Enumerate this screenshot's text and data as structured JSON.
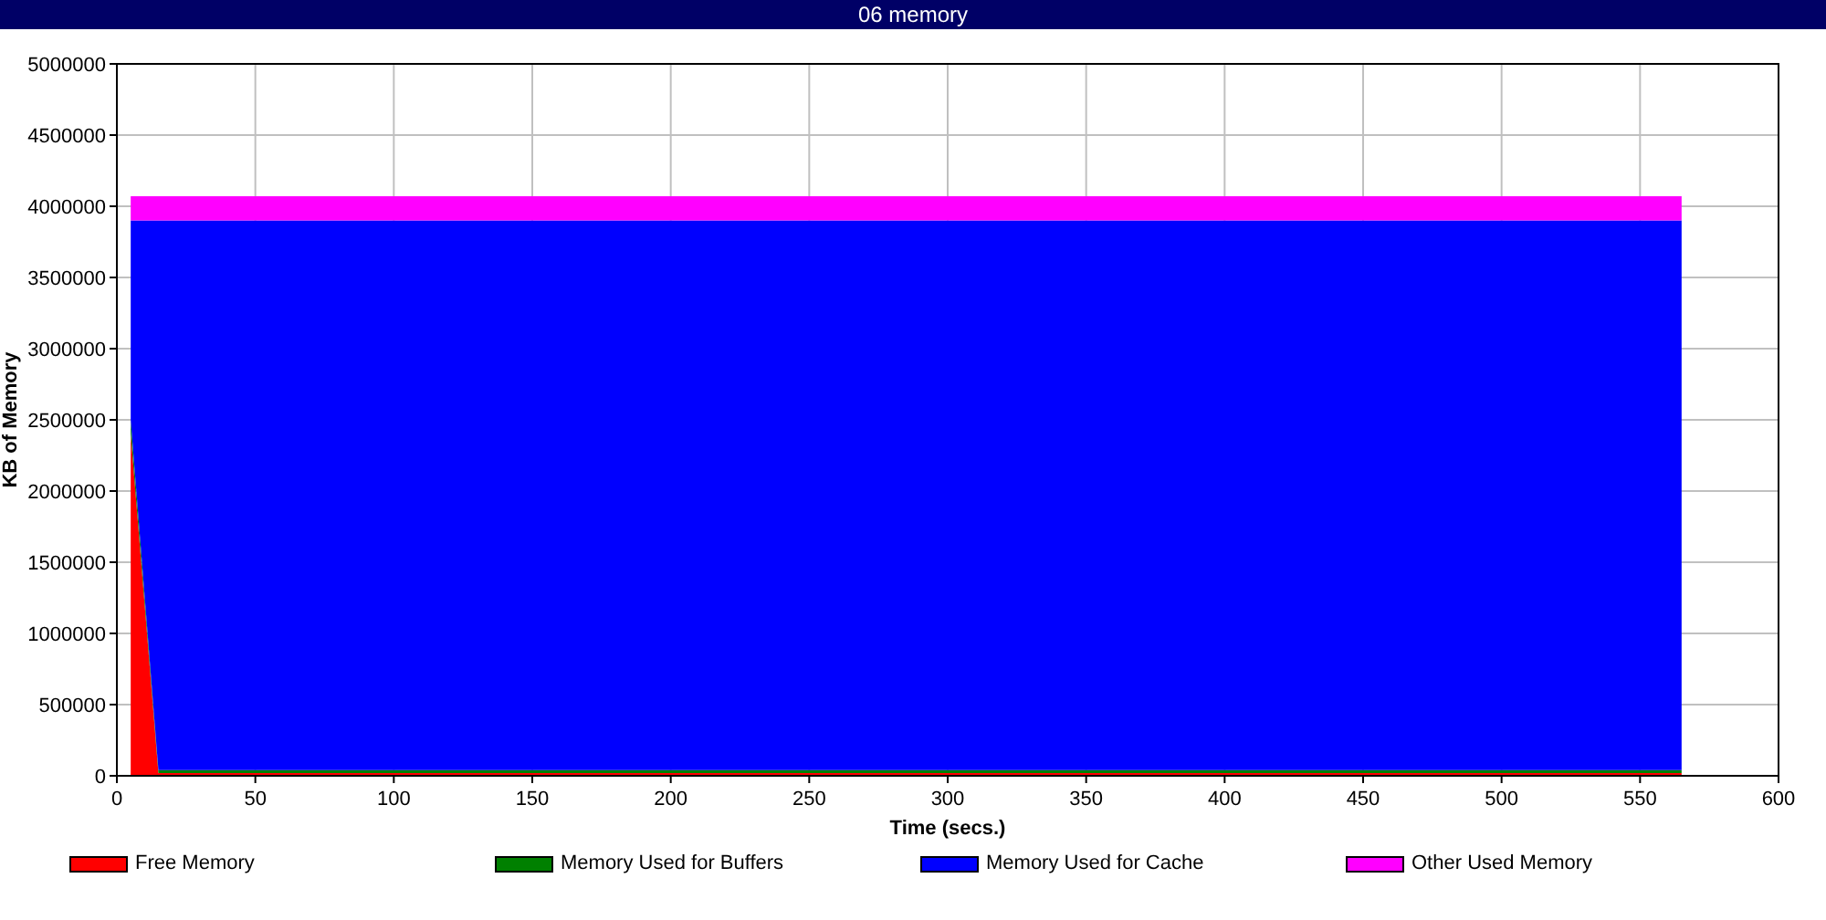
{
  "window": {
    "title": "06 memory"
  },
  "chart": {
    "chart_data": {
      "type": "area",
      "stacked": true,
      "grid": true,
      "xlabel": "Time (secs.)",
      "ylabel": "KB of Memory",
      "x": [
        5,
        15,
        565
      ],
      "xlim": [
        0,
        600
      ],
      "ylim": [
        0,
        5000000
      ],
      "xticks": [
        0,
        50,
        100,
        150,
        200,
        250,
        300,
        350,
        400,
        450,
        500,
        550,
        600
      ],
      "yticks": [
        0,
        500000,
        1000000,
        1500000,
        2000000,
        2500000,
        3000000,
        3500000,
        4000000,
        4500000,
        5000000
      ],
      "series": [
        {
          "name": "Free Memory",
          "color": "#ff0000",
          "values": [
            2400000,
            20000,
            20000
          ]
        },
        {
          "name": "Memory Used for Buffers",
          "color": "#008000",
          "values": [
            100000,
            20000,
            20000
          ]
        },
        {
          "name": "Memory Used for Cache",
          "color": "#0000ff",
          "values": [
            1400000,
            3860000,
            3860000
          ]
        },
        {
          "name": "Other Used Memory",
          "color": "#ff00ff",
          "values": [
            170000,
            170000,
            170000
          ]
        }
      ]
    }
  }
}
